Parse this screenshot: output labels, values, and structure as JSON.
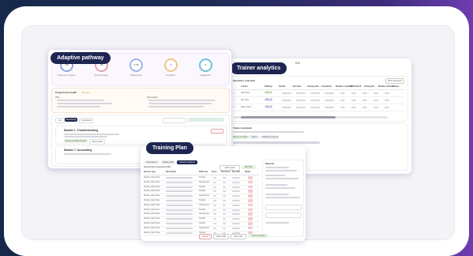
{
  "adaptive": {
    "title": "Adaptive pathway",
    "stats": [
      {
        "value": "1/5",
        "label": "Progressive progress",
        "color": "#8fa6dd"
      },
      {
        "value": "1/5",
        "label": "Quizzes Passed",
        "color": "#e5a0b4"
      },
      {
        "value": "0.46",
        "label": "Training levels",
        "color": "#9cb7e8"
      },
      {
        "value": "0",
        "label": "Completion",
        "color": "#efc58a"
      },
      {
        "value": "5",
        "label": "Engagement",
        "color": "#6cc4d6"
      }
    ],
    "health_title": "Progression health",
    "health_badge": "Review",
    "why_label": "Why",
    "next_label": "Next action",
    "tabs": [
      "All",
      "Remaining",
      "Completed"
    ],
    "modules": [
      "Module 1: Troubleshooting",
      "Module 7: Accounting"
    ],
    "buttons": [
      "Recommended content",
      "View results"
    ]
  },
  "trainer": {
    "title": "Trainer analytics",
    "kpi": "0%",
    "overview_title": "Operators overview",
    "action_button": "Show operators",
    "columns": [
      "Learner",
      "Pathway",
      "Started",
      "End date",
      "Training time",
      "Completion",
      "Modules completed",
      "Diff. Peak lift",
      "Training lift",
      "Modules initiated",
      "Review"
    ],
    "rows": [
      {
        "name": "Sam Boss",
        "tag": "PMS_01",
        "tag_color": "#d9f0d0"
      },
      {
        "name": "Ana Harp",
        "tag": "PMS_02",
        "tag_color": "#e0d4f5"
      },
      {
        "name": "Rachel Moni",
        "tag": "PMS_03",
        "tag_color": "#e0d4f5"
      }
    ],
    "assistant_title": "Trainer assistant",
    "chips": [
      "Recommendation",
      "Topics",
      "Evaluate progress"
    ]
  },
  "plan": {
    "title": "Training Plan",
    "tabs": [
      "All sessions",
      "Mobile skills",
      "Generic sessions"
    ],
    "list_title": "Special Plan (program/profile)",
    "actions": [
      "Add to plan",
      "Edit filter"
    ],
    "columns": [
      "Session type",
      "Description",
      "Skill level",
      "Score",
      "Pre-Score",
      "Due date",
      "Status"
    ],
    "rows": [
      {
        "type": "Module_Daily Task",
        "level": "Tactical",
        "status_color": "#f3c9c9"
      },
      {
        "type": "Module_Daily Task",
        "level": "Operational",
        "status_color": "#f3c9c9"
      },
      {
        "type": "Module_Daily Task",
        "level": "Tactical",
        "status_color": "#f3c9c9"
      },
      {
        "type": "Module_Daily Task",
        "level": "Tactical",
        "status_color": "#f3c9c9"
      },
      {
        "type": "Module_Daily Task",
        "level": "Operational",
        "status_color": "#f3c9c9"
      },
      {
        "type": "Module_Daily Task",
        "level": "Tactical",
        "status_color": "#f3c9c9"
      },
      {
        "type": "Module_Daily Task",
        "level": "Operational",
        "status_color": "#f3c9c9"
      },
      {
        "type": "Module_Advanced",
        "level": "Tactical",
        "status_color": "#f3c9c9"
      },
      {
        "type": "Module_Daily Task",
        "level": "Operational",
        "status_color": "#f3c9c9"
      },
      {
        "type": "Module_Daily Task",
        "level": "Tactical",
        "status_color": "#f3c9c9"
      },
      {
        "type": "Module_Daily Task",
        "level": "Tactical",
        "status_color": "#f3c9c9"
      },
      {
        "type": "Module_Daily Task",
        "level": "Operational",
        "status_color": "#f3c9c9"
      },
      {
        "type": "Module_Daily Task",
        "level": "Tactical",
        "status_color": "#f3c9c9"
      }
    ],
    "side_title": "Options",
    "footer_buttons": [
      "Cancel",
      "Save draft",
      "Save plan",
      "Save & publish"
    ]
  }
}
